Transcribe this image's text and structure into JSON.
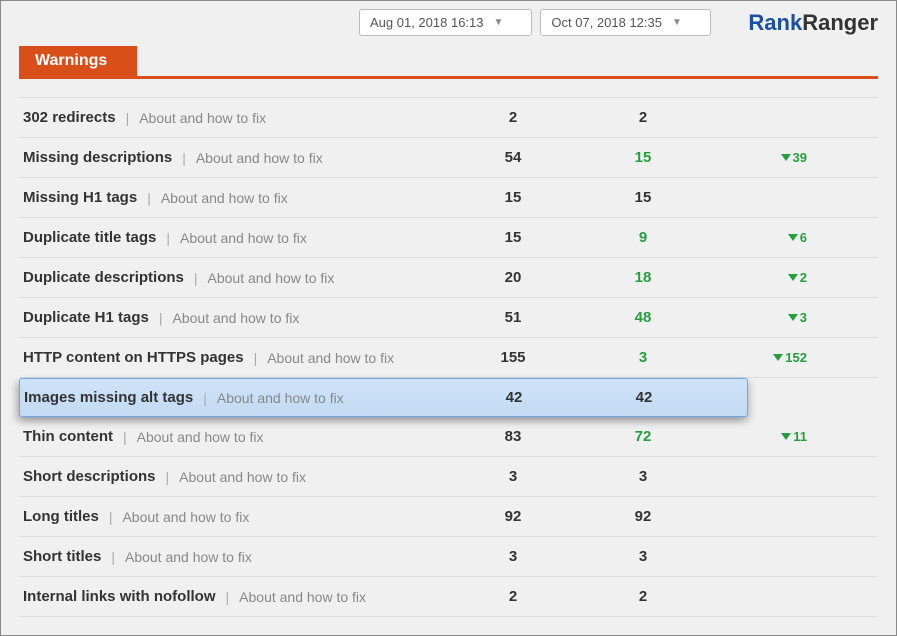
{
  "brand": {
    "part1": "Rank",
    "part2": "Ranger"
  },
  "dates": {
    "d1": "Aug 01, 2018 16:13",
    "d2": "Oct 07, 2018 12:35"
  },
  "tab": {
    "label": "Warnings"
  },
  "about_label": "About and how to fix",
  "rows": [
    {
      "name": "302 redirects",
      "v1": "2",
      "v2": "2",
      "v2_green": false,
      "delta": ""
    },
    {
      "name": "Missing descriptions",
      "v1": "54",
      "v2": "15",
      "v2_green": true,
      "delta": "39"
    },
    {
      "name": "Missing H1 tags",
      "v1": "15",
      "v2": "15",
      "v2_green": false,
      "delta": ""
    },
    {
      "name": "Duplicate title tags",
      "v1": "15",
      "v2": "9",
      "v2_green": true,
      "delta": "6"
    },
    {
      "name": "Duplicate descriptions",
      "v1": "20",
      "v2": "18",
      "v2_green": true,
      "delta": "2"
    },
    {
      "name": "Duplicate H1 tags",
      "v1": "51",
      "v2": "48",
      "v2_green": true,
      "delta": "3"
    },
    {
      "name": "HTTP content on HTTPS pages",
      "v1": "155",
      "v2": "3",
      "v2_green": true,
      "delta": "152"
    },
    {
      "name": "Images missing alt tags",
      "v1": "42",
      "v2": "42",
      "v2_green": false,
      "delta": "",
      "highlight": true
    },
    {
      "name": "Thin content",
      "v1": "83",
      "v2": "72",
      "v2_green": true,
      "delta": "11"
    },
    {
      "name": "Short descriptions",
      "v1": "3",
      "v2": "3",
      "v2_green": false,
      "delta": ""
    },
    {
      "name": "Long titles",
      "v1": "92",
      "v2": "92",
      "v2_green": false,
      "delta": ""
    },
    {
      "name": "Short titles",
      "v1": "3",
      "v2": "3",
      "v2_green": false,
      "delta": ""
    },
    {
      "name": "Internal links with nofollow",
      "v1": "2",
      "v2": "2",
      "v2_green": false,
      "delta": ""
    }
  ]
}
